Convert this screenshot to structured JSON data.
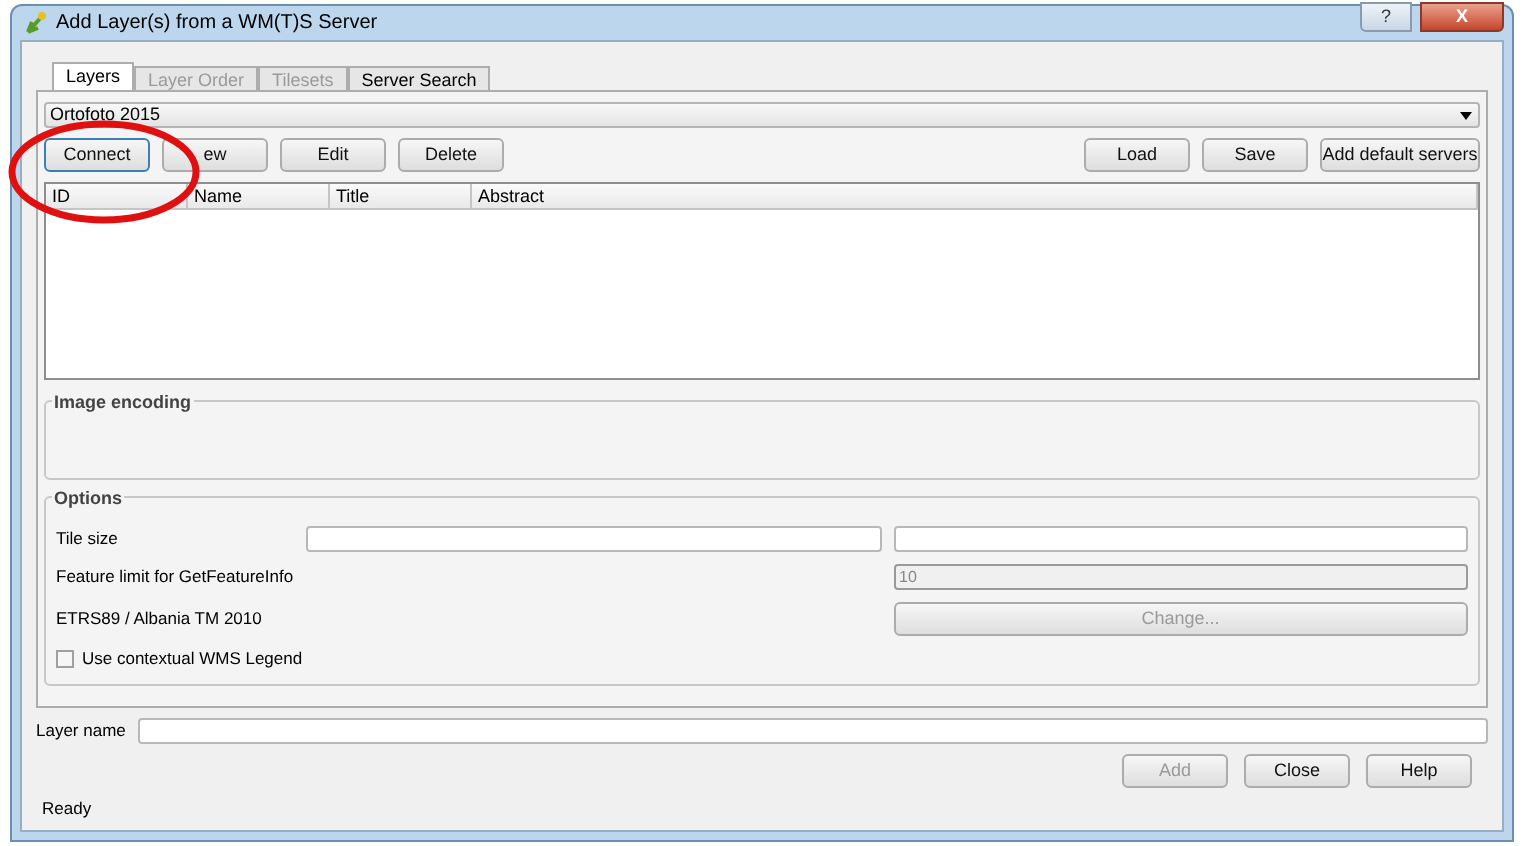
{
  "window": {
    "title": "Add Layer(s) from a WM(T)S Server",
    "help_button": "?",
    "close_button": "X"
  },
  "tabs": [
    {
      "label": "Layers",
      "selected": true,
      "disabled": false
    },
    {
      "label": "Layer Order",
      "selected": false,
      "disabled": true
    },
    {
      "label": "Tilesets",
      "selected": false,
      "disabled": true
    },
    {
      "label": "Server Search",
      "selected": false,
      "disabled": false
    }
  ],
  "connection": {
    "value": "Ortofoto 2015"
  },
  "left_buttons": [
    {
      "label": "Connect",
      "selected": true
    },
    {
      "label": "ew",
      "selected": false
    },
    {
      "label": "Edit",
      "selected": false
    },
    {
      "label": "Delete",
      "selected": false
    }
  ],
  "right_buttons": [
    "Load",
    "Save",
    "Add default servers"
  ],
  "table": {
    "columns": [
      "ID",
      "Name",
      "Title",
      "Abstract"
    ]
  },
  "image_encoding": {
    "title": "Image encoding"
  },
  "options": {
    "title": "Options",
    "tile_size_label": "Tile size",
    "feature_limit_label": "Feature limit for GetFeatureInfo",
    "feature_limit": {
      "value": "10",
      "disabled": true
    },
    "crs_label": "ETRS89 / Albania TM 2010",
    "change_button": {
      "label": "Change...",
      "disabled": true
    },
    "legend_checkbox": {
      "label": "Use contextual WMS Legend",
      "checked": false
    }
  },
  "layer_name": {
    "label": "Layer name"
  },
  "dialog_buttons": [
    {
      "label": "Add",
      "disabled": true
    },
    {
      "label": "Close",
      "disabled": false
    },
    {
      "label": "Help",
      "disabled": false
    }
  ],
  "status_bar": "Ready"
}
